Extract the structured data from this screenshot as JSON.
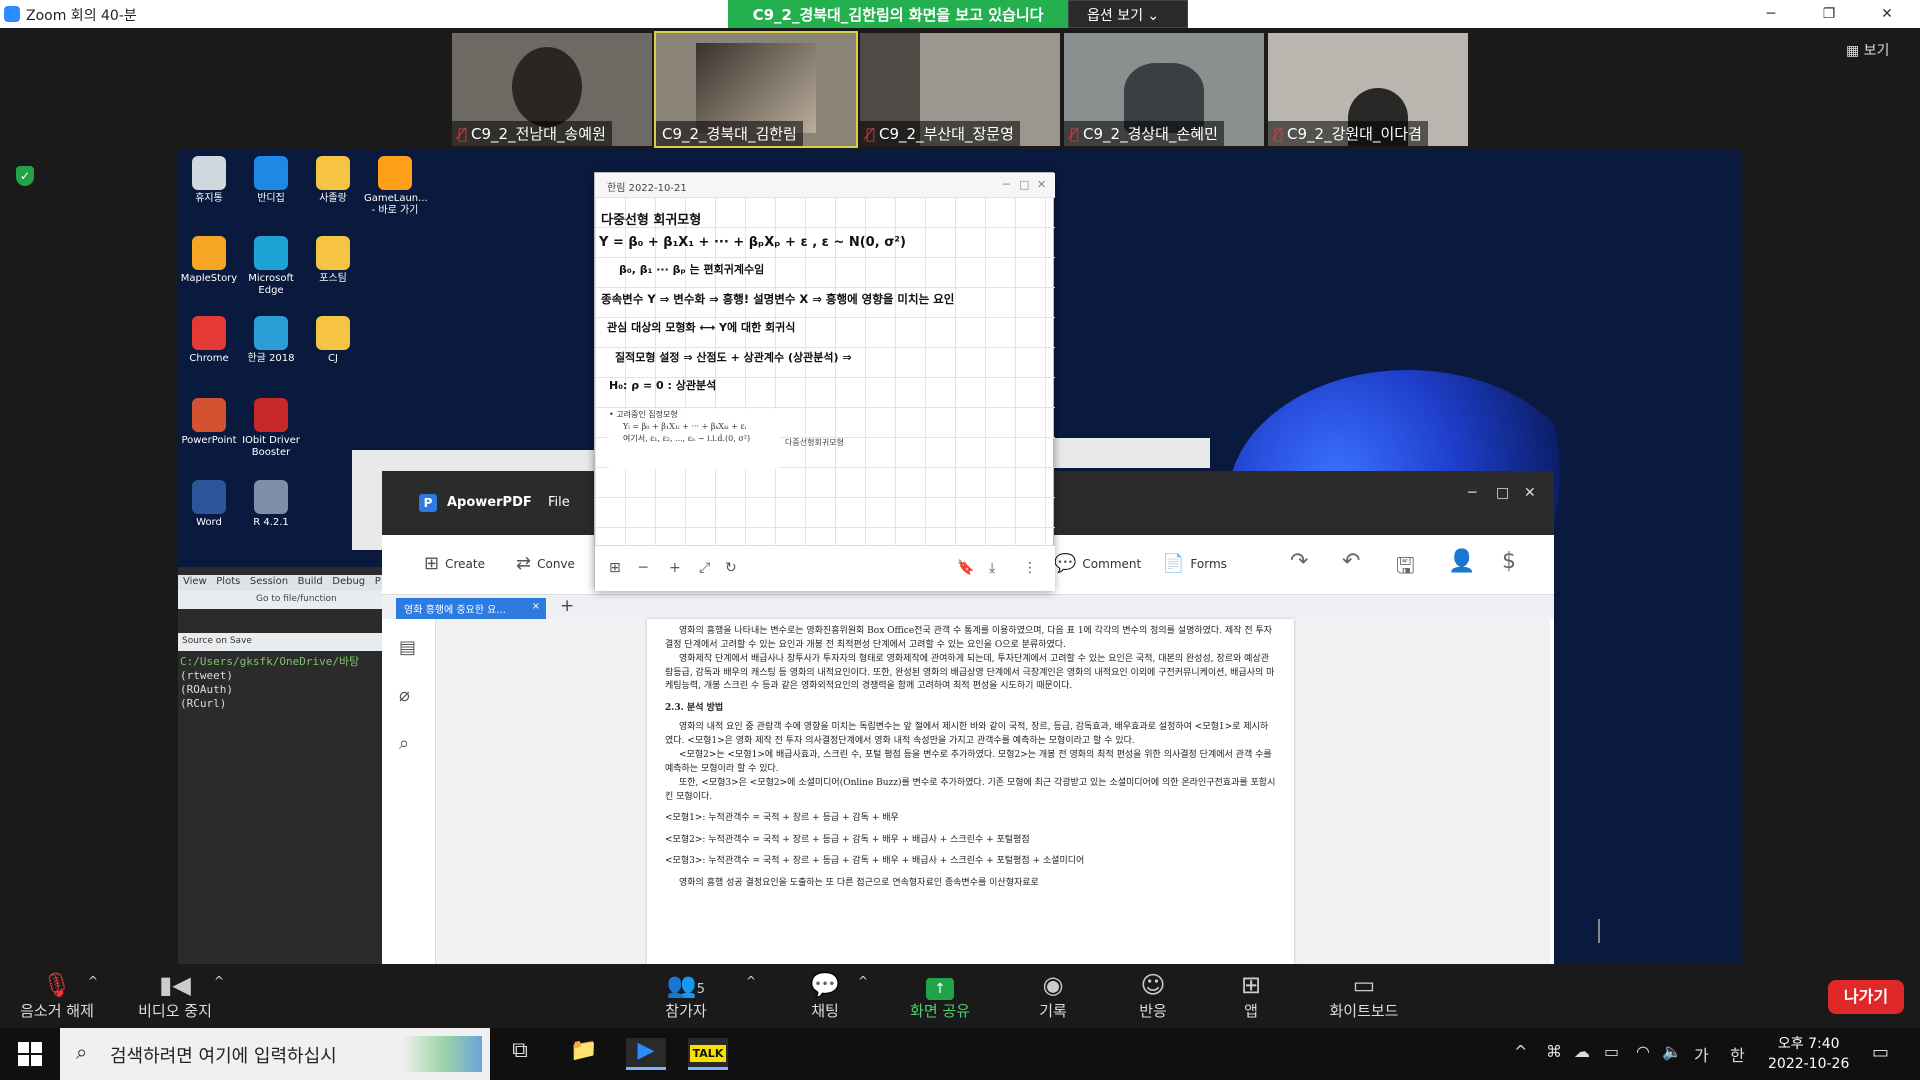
{
  "window": {
    "title": "Zoom 회의 40-분",
    "minimize": "─",
    "restore": "❐",
    "close": "✕"
  },
  "share_banner": {
    "text": "C9_2_경북대_김한림의 화면을 보고 있습니다",
    "options_label": "옵션 보기 ⌄"
  },
  "participants": [
    {
      "name": "C9_2_전남대_송예원",
      "muted": true
    },
    {
      "name": "C9_2_경북대_김한림",
      "muted": false
    },
    {
      "name": "C9_2_부산대_장문영",
      "muted": true
    },
    {
      "name": "C9_2_경상대_손혜민",
      "muted": true
    },
    {
      "name": "C9_2_강원대_이다겸",
      "muted": true
    }
  ],
  "view_button": "▦ 보기",
  "desktop_icons": [
    {
      "label": "휴지통",
      "color": "#cfd8dc"
    },
    {
      "label": "반디집",
      "color": "#1e88e5"
    },
    {
      "label": "사졸랑",
      "color": "#f6c342"
    },
    {
      "label": "GameLaun... - 바로 가기",
      "color": "#ff9f1a"
    },
    {
      "label": "MapleStory",
      "color": "#f6a623"
    },
    {
      "label": "Microsoft Edge",
      "color": "#1fa3d4"
    },
    {
      "label": "포스팀",
      "color": "#f6c342"
    },
    {
      "label": "Chrome",
      "color": "#e53935"
    },
    {
      "label": "한글 2018",
      "color": "#2a9fd6"
    },
    {
      "label": "CJ",
      "color": "#f6c342"
    },
    {
      "label": "PowerPoint",
      "color": "#d35230"
    },
    {
      "label": "IObit Driver Booster",
      "color": "#c62828"
    },
    {
      "label": "Word",
      "color": "#2b579a"
    },
    {
      "label": "R 4.2.1",
      "color": "#7d8fa6"
    }
  ],
  "rstudio": {
    "menu": [
      "View",
      "Plots",
      "Session",
      "Build",
      "Debug",
      "P"
    ],
    "goto": "Go to file/function",
    "source_on_save": "Source on Save",
    "path": "C:/Users/gksfk/OneDrive/바탕",
    "lines": [
      "(rtweet)",
      "(ROAuth)",
      "(RCurl)"
    ]
  },
  "note": {
    "title": "한림  2022-10-21",
    "controls": [
      "─",
      "□",
      "✕"
    ],
    "lines": [
      "다중선형 회귀모형",
      "Y = β₀ + β₁X₁ + ··· + βₚXₚ + ε , ε ~ N(0, σ²)",
      "β₀, β₁ ··· βₚ 는 편회귀계수임",
      "종속변수 Y ⇒ 변수화 ⇒ 흥행!   설명변수 X ⇒ 흥행에 영향을 미치는 요인",
      "관심 대상의 모형화  ⟷  Y에 대한 회귀식",
      "질적모형 설정 ⇒ 산점도 + 상관계수 (상관분석) ⇒",
      "H₀: ρ = 0 : 상관분석"
    ],
    "inset_title": "• 고려중인 집정모형",
    "inset_eq": "Yᵢ = β₀ + β₁X₁ᵢ + ··· + βₖXₖᵢ + εᵢ",
    "inset_eq2": "여기서,  ε₁, ε₂, ..., εₙ ~ i.i.d.(0, σ²)",
    "inset_label": "다중선형회귀모형",
    "bottom_tools": [
      "⊞",
      "─",
      "+",
      "⤢",
      "↻",
      "🔖",
      "⤓",
      "⋮"
    ]
  },
  "apower": {
    "app_name": "ApowerPDF",
    "menu_file": "File",
    "controls": [
      "─",
      "□",
      "✕"
    ],
    "tools": {
      "create": "Create",
      "convert": "Conve",
      "comment": "Comment",
      "forms": "Forms"
    },
    "tab": "영화 흥행에 중요한 요...",
    "page_paragraphs": [
      "영화의 흥행을 나타내는 변수로는 영화진흥위원회 Box Office전국 관객 수 통계를 이용하였으며, 다음 표 1에 각각의 변수의 정의를 설명하였다. 제작 전 투자결정 단계에서 고려할 수 있는 요인과 개봉 전 최적편성 단계에서 고려할 수 있는 요인을 O으로 분류하였다.",
      "영화제작 단계에서 배급사나 창투사가 투자자의 형태로 영화제작에 관여하게 되는데, 투자단계에서 고려할 수 있는 요인은 국적, 대본의 완성성, 장르와 예상관람등급, 감독과 배우의 캐스팅 등 영화의 내적요인이다. 또한, 완성된 영화의 배급상영 단계에서 극장계인은 영화의 내적요인 이외에 구전커뮤니케이션, 배급사의 마케팅능력, 개봉 스크린 수 등과 같은 영화외적요인의 경쟁력을 함께 고려하여 최적 편성을 시도하기 때문이다."
    ],
    "section_title": "2.3. 분석 방법",
    "page_paragraphs2": [
      "영화의 내적 요인 중 관람객 수에 영향을 미치는 독립변수는 앞 절에서 제시한 바와 같이 국적, 장르, 등급, 감독효과, 배우효과로 설정하여 <모형1>로 제시하였다. <모형1>은 영화 제작 전 투자 의사결정단계에서 영화 내적 속성만을 가지고 관객수를 예측하는 모형이라고 할 수 있다.",
      "<모형2>는 <모형1>에 배급사효과, 스크린 수, 포털 평점 등을 변수로 추가하였다. 모형2>는 개봉 전 영화의 최적 편성을 위한 의사결정 단계에서 관객 수를 예측하는 모형이라 할 수 있다.",
      "또한, <모형3>은 <모형2>에 소셜미디어(Online Buzz)를 변수로 추가하였다. 기존 모형에 최근 각광받고 있는 소셜미디어에 의한 온라인구전효과를 포함시킨 모형이다."
    ],
    "models": [
      "<모형1>: 누적관객수 = 국적 + 장르 + 등급 + 감독 + 배우",
      "<모형2>: 누적관객수 = 국적 + 장르 + 등급 + 감독 + 배우 + 배급사 + 스크린수 + 포털평점",
      "<모형3>: 누적관객수 = 국적 + 장르 + 등급 + 감독 + 배우 + 배급사 + 스크린수 + 포털평점 + 소셜미디어"
    ],
    "last_line": "영화의 흥행 성공 결정요인을 도출하는 또 다른 접근으로 연속형자료인 종속변수를 이산형자료로"
  },
  "toolbar": {
    "mute": "음소거 해제",
    "video": "비디오 중지",
    "participants": "참가자",
    "participants_count": "5",
    "chat": "채팅",
    "share": "화면 공유",
    "record": "기록",
    "reactions": "반응",
    "apps": "앱",
    "whiteboard": "화이트보드",
    "leave": "나가기"
  },
  "taskbar": {
    "search_placeholder": "검색하려면 여기에 입력하십시",
    "time": "오후 7:40",
    "date": "2022-10-26",
    "ime": "가",
    "lang": "한"
  }
}
